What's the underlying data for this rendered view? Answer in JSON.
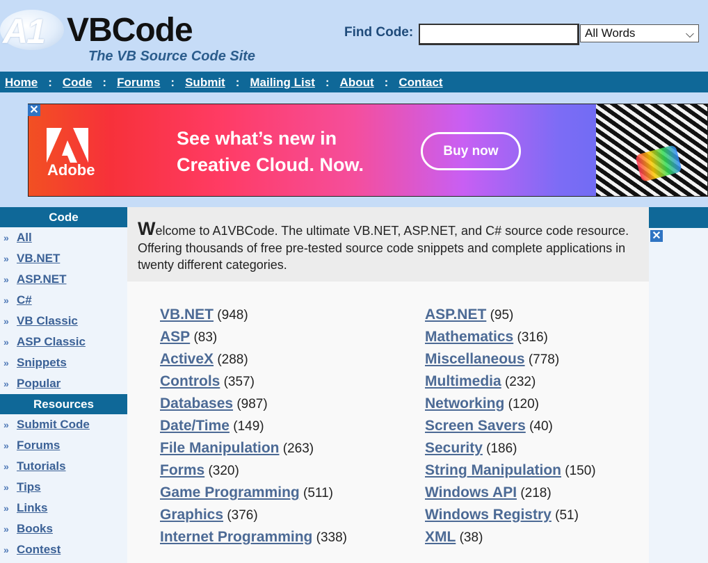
{
  "header": {
    "logo_prefix": "A1",
    "logo_name": "VBCode",
    "tagline": "The VB Source Code Site",
    "find_label": "Find Code:",
    "find_value": "",
    "find_scope": "All Words"
  },
  "nav": [
    "Home",
    "Code",
    "Forums",
    "Submit",
    "Mailing List",
    "About",
    "Contact"
  ],
  "nav_separator": ":",
  "ad": {
    "brand": "Adobe",
    "line1": "See what’s new in",
    "line2": "Creative Cloud. Now.",
    "cta": "Buy now",
    "close_icon": "✕"
  },
  "sidebar": {
    "code_heading": "Code",
    "code_items": [
      "All",
      "VB.NET",
      "ASP.NET",
      "C#",
      "VB Classic",
      "ASP Classic",
      "Snippets",
      "Popular"
    ],
    "resources_heading": "Resources",
    "resource_items": [
      "Submit Code",
      "Forums",
      "Tutorials",
      "Tips",
      "Links",
      "Books",
      "Contest"
    ],
    "bullet": "»"
  },
  "welcome": {
    "dropcap": "W",
    "text": "elcome to A1VBCode. The ultimate VB.NET, ASP.NET, and C# source code resource. Offering thousands of free pre-tested source code snippets and complete applications in twenty different categories."
  },
  "categories_left": [
    {
      "name": "VB.NET",
      "count": "(948)"
    },
    {
      "name": "ASP",
      "count": "(83)"
    },
    {
      "name": "ActiveX",
      "count": "(288)"
    },
    {
      "name": "Controls",
      "count": "(357)"
    },
    {
      "name": "Databases",
      "count": "(987)"
    },
    {
      "name": "Date/Time",
      "count": "(149)"
    },
    {
      "name": "File Manipulation",
      "count": "(263)"
    },
    {
      "name": "Forms",
      "count": "(320)"
    },
    {
      "name": "Game Programming",
      "count": "(511)"
    },
    {
      "name": "Graphics",
      "count": "(376)"
    },
    {
      "name": "Internet Programming",
      "count": "(338)"
    }
  ],
  "categories_right": [
    {
      "name": "ASP.NET",
      "count": "(95)"
    },
    {
      "name": "Mathematics",
      "count": "(316)"
    },
    {
      "name": "Miscellaneous",
      "count": "(778)"
    },
    {
      "name": "Multimedia",
      "count": "(232)"
    },
    {
      "name": "Networking",
      "count": "(120)"
    },
    {
      "name": "Screen Savers",
      "count": "(40)"
    },
    {
      "name": "Security",
      "count": "(186)"
    },
    {
      "name": "String Manipulation",
      "count": "(150)"
    },
    {
      "name": "Windows API",
      "count": "(218)"
    },
    {
      "name": "Windows Registry",
      "count": "(51)"
    },
    {
      "name": "XML",
      "count": "(38)"
    }
  ],
  "colors": {
    "header_bg": "#c6dcf7",
    "nav_bg": "#0f6898",
    "link": "#4c6a95"
  }
}
